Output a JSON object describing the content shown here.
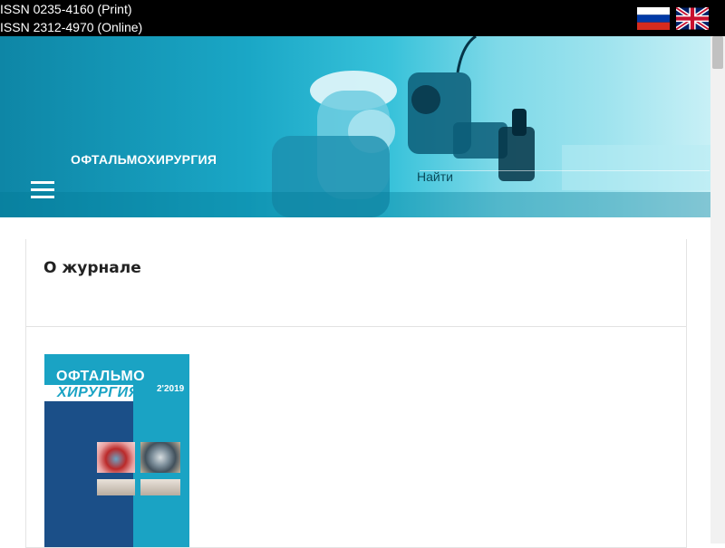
{
  "header": {
    "issn_print": "ISSN 0235-4160 (Print)",
    "issn_online": "ISSN 2312-4970 (Online)",
    "lang_ru": "russian-flag",
    "lang_en": "uk-flag"
  },
  "banner": {
    "title": "ОФТАЛЬМОХИРУРГИЯ",
    "find_label": "Найти"
  },
  "content": {
    "section_title": "О журнале"
  },
  "cover": {
    "title_line1": "ОФТАЛЬМО",
    "title_line2": "ХИРУРГИЯ",
    "issue": "2'2019"
  },
  "colors": {
    "topbar": "#000000",
    "banner": "#1aa7c6",
    "cover_blue": "#1b4f88",
    "cover_cyan": "#1aa3c4"
  }
}
